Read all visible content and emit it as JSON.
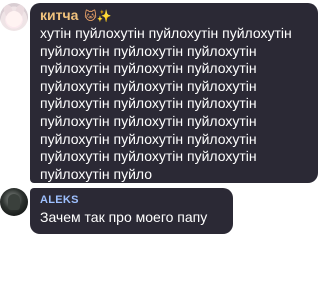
{
  "messages": [
    {
      "author": "китча",
      "author_emoji": "🐱",
      "author_sparkle": "✨",
      "text": "хутін пуйлохутін пуйлохутін пуйлохутін\nпуйлохутін пуйлохутін пуйлохутін\nпуйлохутін пуйлохутін пуйлохутін\nпуйлохутін пуйлохутін пуйлохутін\nпуйлохутін пуйлохутін пуйлохутін\nпуйлохутін пуйлохутін пуйлохутін\nпуйлохутін пуйлохутін пуйлохутін\nпуйлохутін пуйлохутін пуйлохутін\nпуйлохутін пуйло",
      "author_color": "#f1c27d"
    },
    {
      "author": "ALEKS",
      "text": "Зачем так про моего папу",
      "author_color": "#9ec0ff"
    }
  ],
  "colors": {
    "bubble": "#2b2935",
    "background": "#ffffff"
  }
}
